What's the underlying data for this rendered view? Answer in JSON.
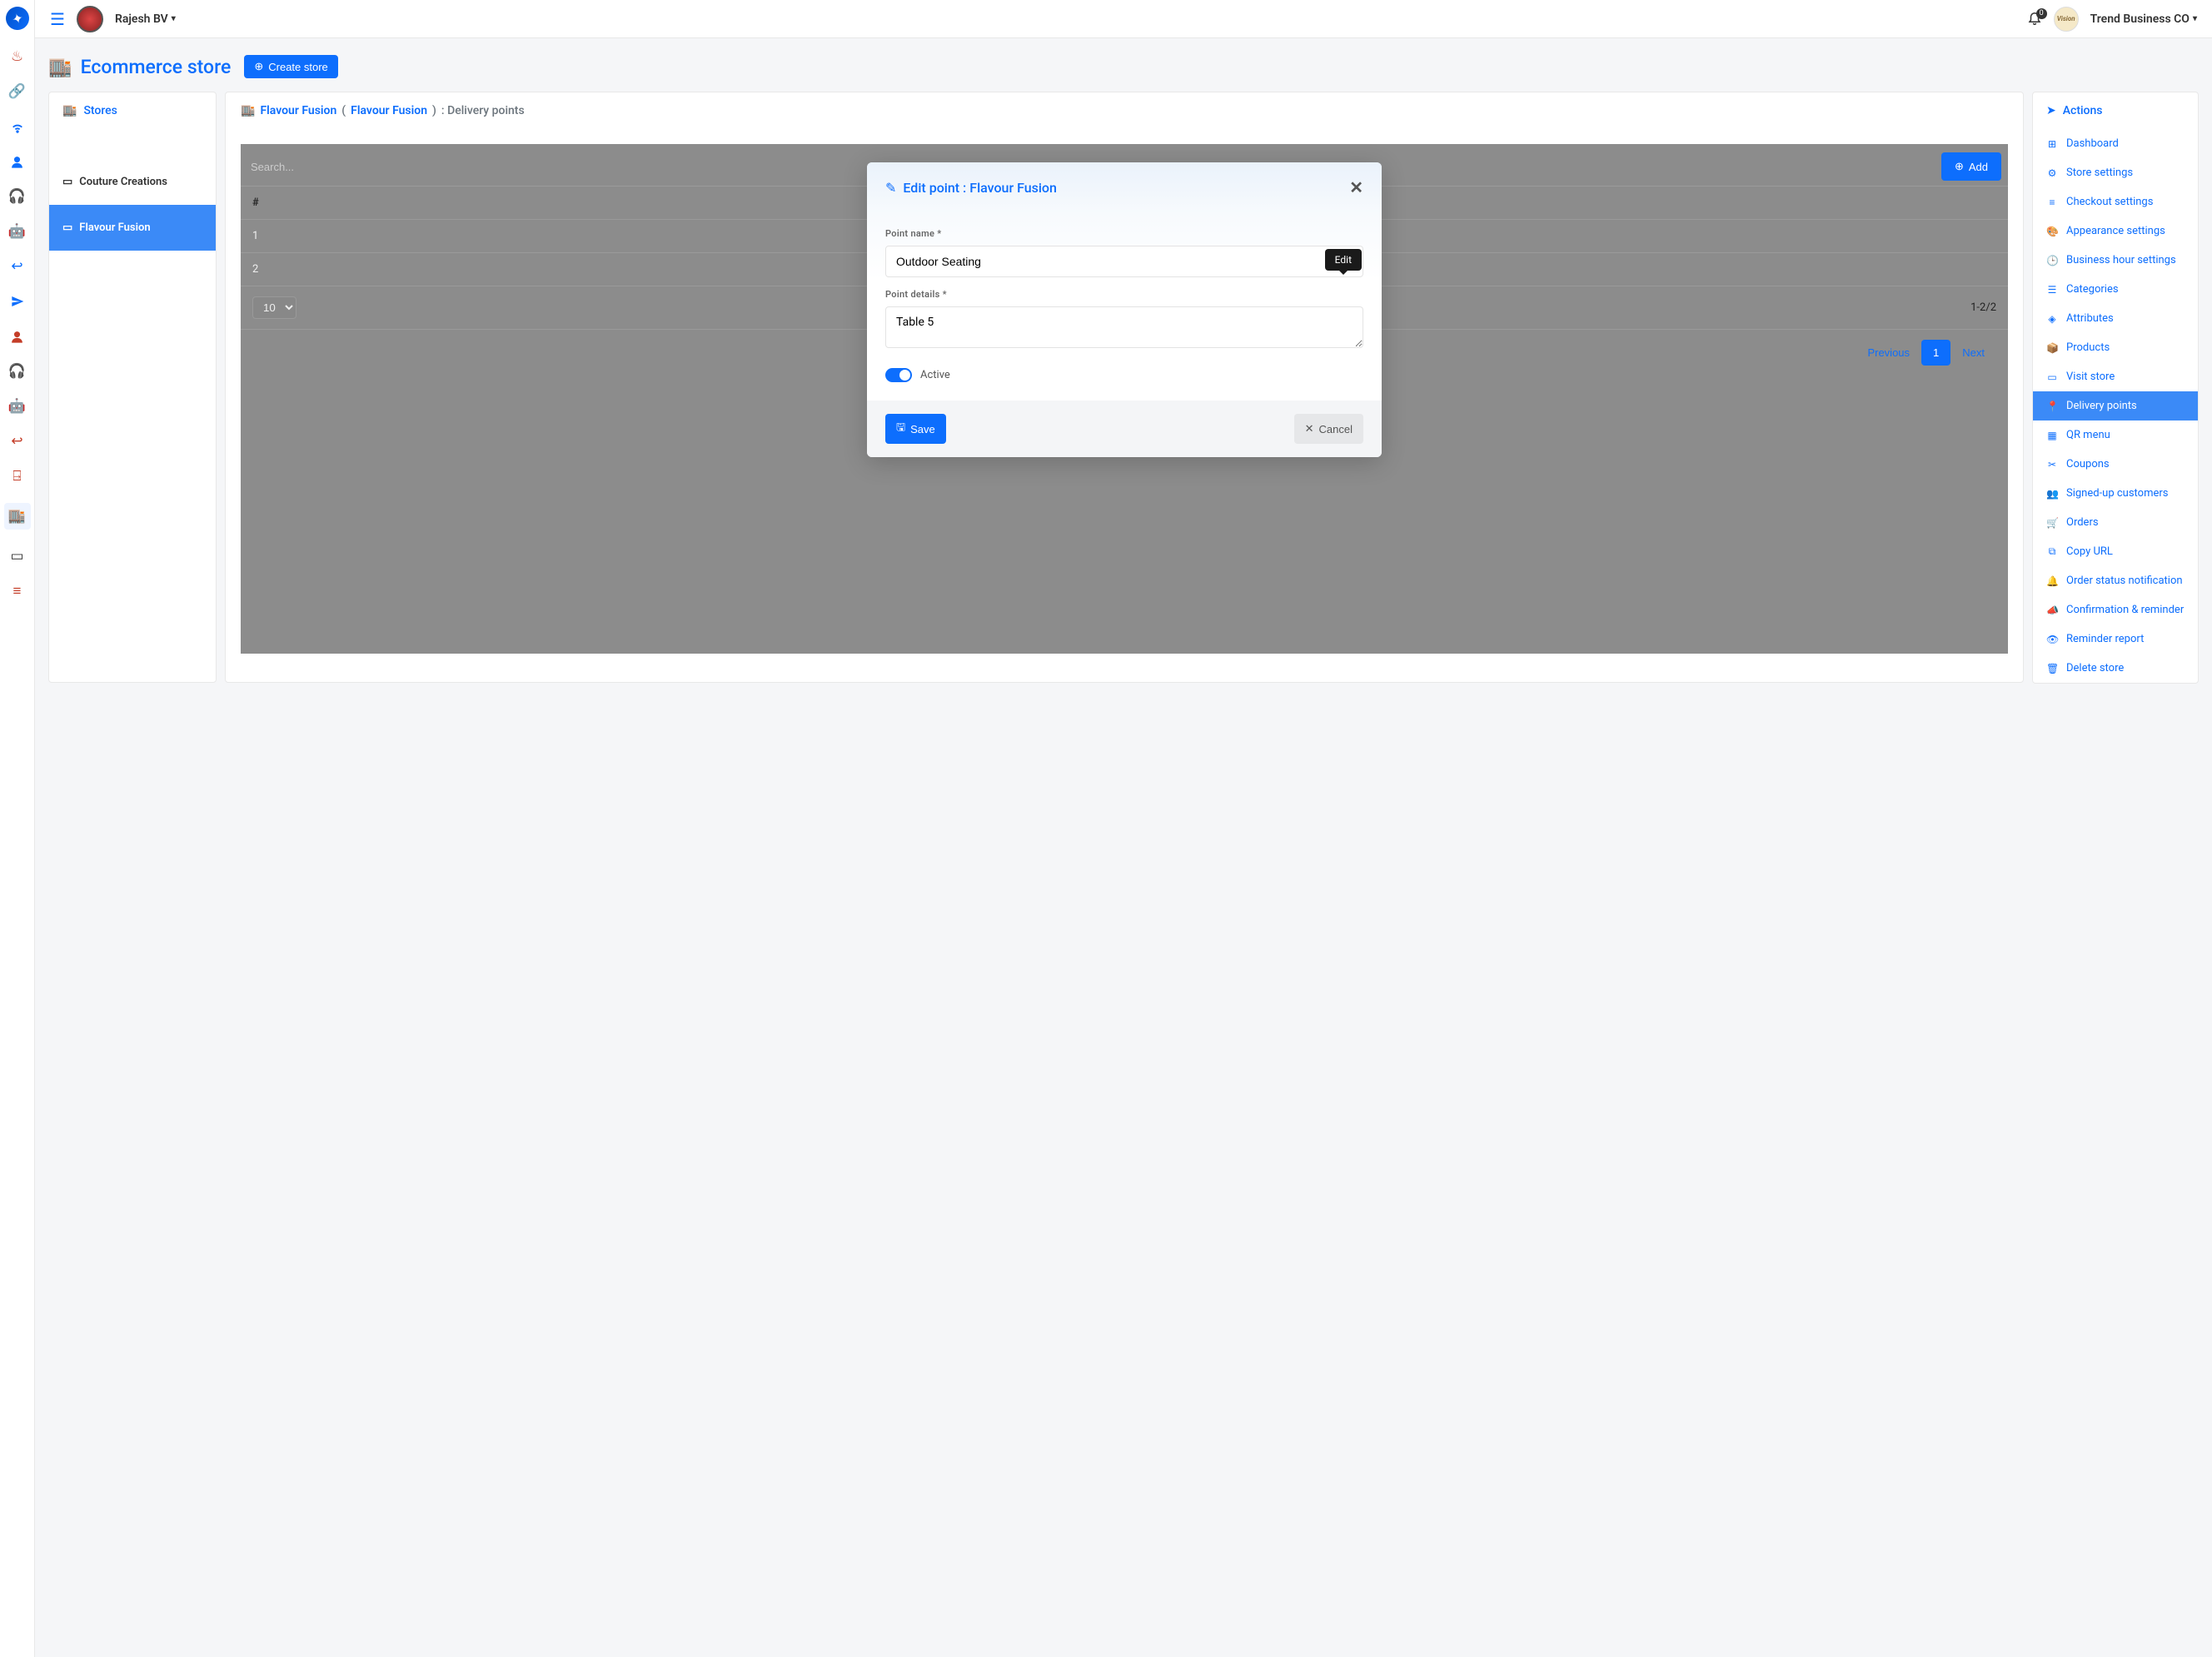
{
  "header": {
    "user_name": "Rajesh BV",
    "notif_count": "0",
    "business_name": "Trend Business CO",
    "business_logo_text": "Vision"
  },
  "page": {
    "title": "Ecommerce store",
    "create_btn": "Create store"
  },
  "stores_panel": {
    "heading": "Stores",
    "items": [
      "Couture Creations",
      "Flavour Fusion"
    ],
    "active_index": 1
  },
  "center": {
    "store_link": "Flavour Fusion",
    "paren_open": " ( ",
    "store_link2": "Flavour Fusion",
    "paren_close": " ) ",
    "tail": ": Delivery points",
    "search_placeholder": "Search...",
    "add_btn": "Add",
    "col_num": "#",
    "rows": [
      "1",
      "2"
    ],
    "page_size": "10",
    "range": "1-2/2",
    "prev": "Previous",
    "page1": "1",
    "next": "Next"
  },
  "modal": {
    "title": "Edit point : Flavour Fusion",
    "label_name": "Point name *",
    "value_name": "Outdoor Seating",
    "label_details": "Point details *",
    "value_details": "Table 5",
    "active_label": "Active",
    "save": "Save",
    "cancel": "Cancel",
    "tooltip": "Edit"
  },
  "actions": {
    "heading": "Actions",
    "items": [
      "Dashboard",
      "Store settings",
      "Checkout settings",
      "Appearance settings",
      "Business hour settings",
      "Categories",
      "Attributes",
      "Products",
      "Visit store",
      "Delivery points",
      "QR menu",
      "Coupons",
      "Signed-up customers",
      "Orders",
      "Copy URL",
      "Order status notification",
      "Confirmation & reminder",
      "Reminder report",
      "Delete store"
    ],
    "active_index": 9
  }
}
